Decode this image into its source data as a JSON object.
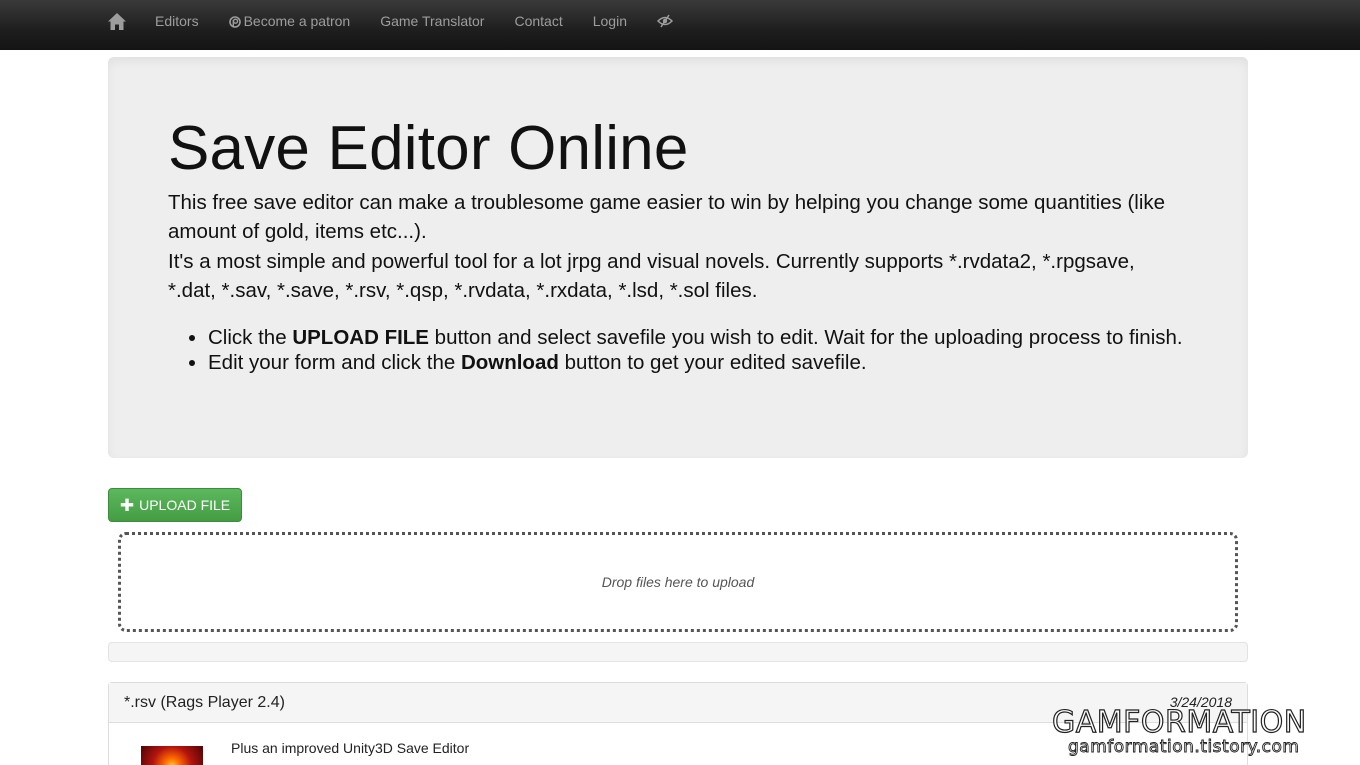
{
  "nav": {
    "home_icon": "home-icon",
    "links": [
      {
        "label": "Editors"
      },
      {
        "label": "Become a patron",
        "icon": "patreon-icon"
      },
      {
        "label": "Game Translator"
      },
      {
        "label": "Contact"
      },
      {
        "label": "Login"
      }
    ],
    "extra_icon": "eye-slash-icon"
  },
  "jumbotron": {
    "title": "Save Editor Online",
    "p1": "This free save editor can make a troublesome game easier to win by helping you change some quantities (like amount of gold, items etc...).",
    "p2": "It's a most simple and powerful tool for a lot jrpg and visual novels. Currently supports *.rvdata2, *.rpgsave, *.dat, *.sav, *.save, *.rsv, *.qsp, *.rvdata, *.rxdata, *.lsd, *.sol files.",
    "steps": [
      {
        "before": "Click the ",
        "bold": "UPLOAD FILE",
        "after": " button and select savefile you wish to edit. Wait for the uploading process to finish."
      },
      {
        "before": "Edit your form and click the ",
        "bold": "Download",
        "after": " button to get your edited savefile."
      }
    ]
  },
  "upload": {
    "button_label": "UPLOAD FILE",
    "dropzone_text": "Drop files here to upload"
  },
  "panel": {
    "title": "*.rsv (Rags Player 2.4)",
    "date": "3/24/2018",
    "line1": "Plus an improved Unity3D Save Editor"
  },
  "watermark": {
    "main": "GAMFORMATION",
    "sub": "gamformation.tistory.com"
  },
  "colors": {
    "navbar": "#222222",
    "jumbotron": "#eeeeee",
    "success": "#5cb85c"
  }
}
